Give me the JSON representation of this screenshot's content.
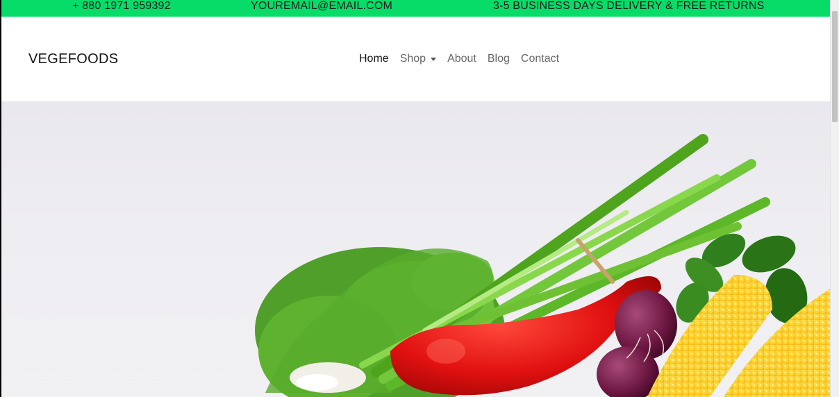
{
  "topbar": {
    "phone": "+ 880 1971 959392",
    "email": "YOUREMAIL@EMAIL.COM",
    "delivery": "3-5 BUSINESS DAYS DELIVERY & FREE RETURNS",
    "bg_color": "#07dc69"
  },
  "navbar": {
    "brand": "VEGEFOODS",
    "items": [
      {
        "label": "Home",
        "active": true
      },
      {
        "label": "Shop",
        "dropdown": true
      },
      {
        "label": "About"
      },
      {
        "label": "Blog"
      },
      {
        "label": "Contact"
      }
    ]
  },
  "hero": {
    "image": "fresh-vegetables-photo",
    "icons": [
      "chevron-down-icon"
    ]
  }
}
